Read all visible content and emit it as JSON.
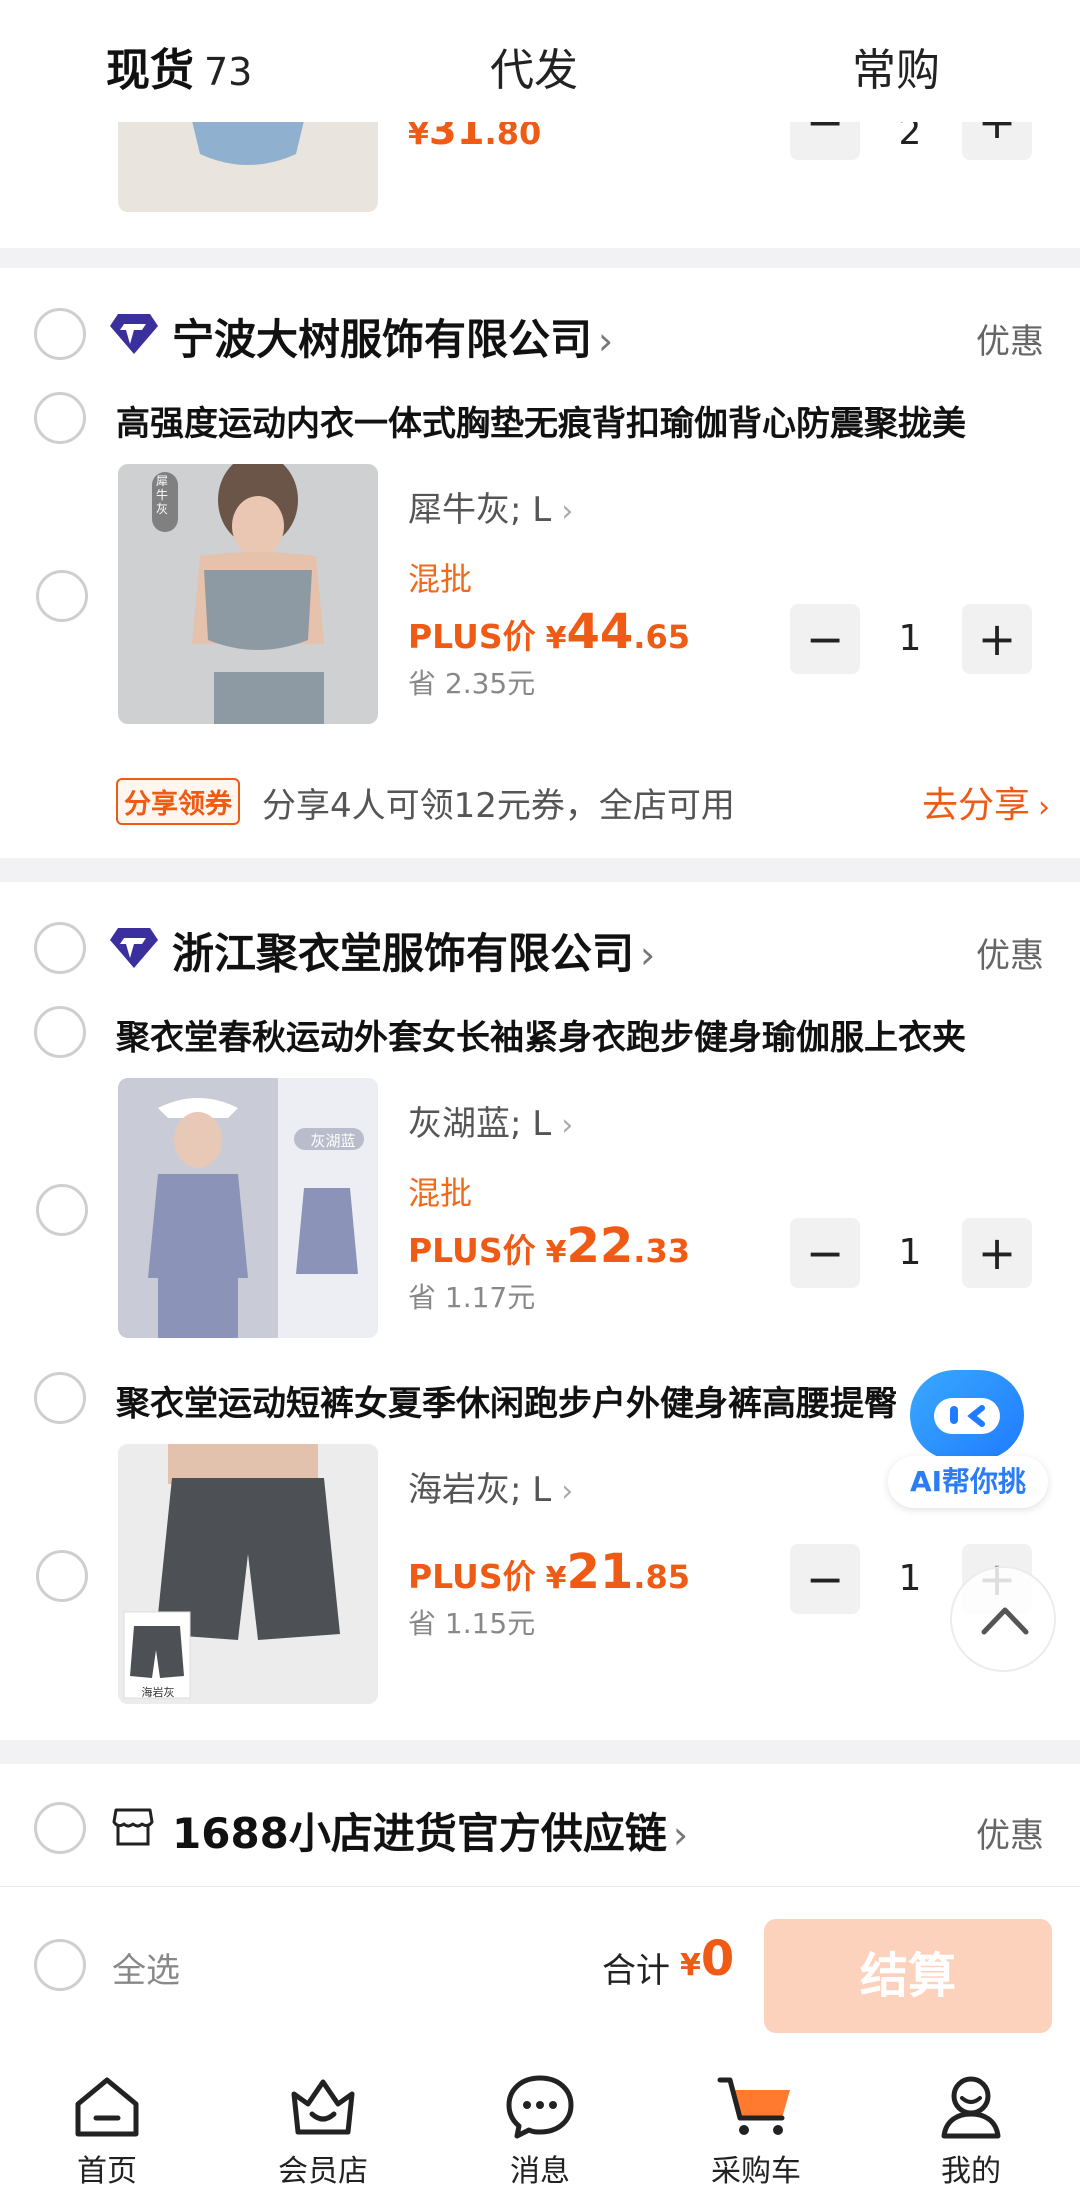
{
  "tabs": [
    {
      "label": "现货",
      "count": "73"
    },
    {
      "label": "代发"
    },
    {
      "label": "常购"
    }
  ],
  "partial_item": {
    "price_yen": "¥",
    "price_int": "31",
    "price_dec": ".80",
    "qty": "2"
  },
  "shops": [
    {
      "name": "宁波大树服饰有限公司",
      "promo": "优惠",
      "items": [
        {
          "title": "高强度运动内衣一体式胸垫无痕背扣瑜伽背心防震聚拢美",
          "thumb_tag": "犀牛灰",
          "spec": "犀牛灰; L",
          "mix": "混批",
          "plus_label": "PLUS价",
          "yen": "¥",
          "price_int": "44",
          "price_dec": ".65",
          "save": "省 2.35元",
          "qty": "1"
        }
      ],
      "coupon": {
        "badge": "分享领券",
        "text": "分享4人可领12元券，全店可用",
        "action": "去分享"
      }
    },
    {
      "name": "浙江聚衣堂服饰有限公司",
      "promo": "优惠",
      "items": [
        {
          "title": "聚衣堂春秋运动外套女长袖紧身衣跑步健身瑜伽服上衣夹",
          "thumb_tag": "灰湖蓝",
          "spec": "灰湖蓝; L",
          "mix": "混批",
          "plus_label": "PLUS价",
          "yen": "¥",
          "price_int": "22",
          "price_dec": ".33",
          "save": "省 1.17元",
          "qty": "1"
        },
        {
          "title": "聚衣堂运动短裤女夏季休闲跑步户外健身裤高腰提臀瑜伽家",
          "thumb_tag": "海岩灰",
          "spec": "海岩灰; L",
          "plus_label": "PLUS价",
          "yen": "¥",
          "price_int": "21",
          "price_dec": ".85",
          "save": "省 1.15元",
          "qty": "1"
        }
      ]
    },
    {
      "name": "1688小店进货官方供应链",
      "promo": "优惠"
    }
  ],
  "ai_helper": {
    "label": "AI帮你挑"
  },
  "checkout": {
    "select_all": "全选",
    "total_label": "合计",
    "yen": "¥",
    "total": "0",
    "settle": "结算"
  },
  "nav": [
    {
      "label": "首页",
      "icon": "home-icon"
    },
    {
      "label": "会员店",
      "icon": "member-store-icon"
    },
    {
      "label": "消息",
      "icon": "message-icon"
    },
    {
      "label": "采购车",
      "icon": "cart-icon"
    },
    {
      "label": "我的",
      "icon": "profile-icon"
    }
  ],
  "colors": {
    "accent": "#ef5a14",
    "settle_disabled": "#fdd2bd",
    "ai_blue": "#2b7cf6"
  }
}
